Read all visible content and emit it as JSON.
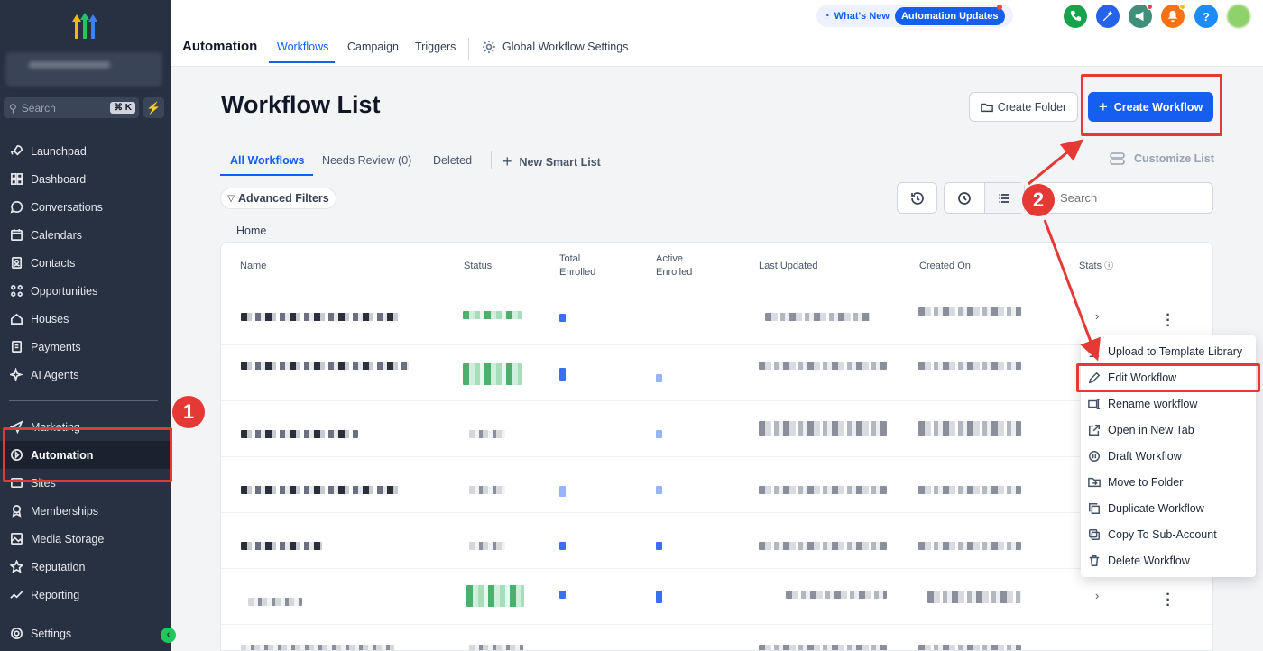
{
  "colors": {
    "sidebar_bg": "#273142",
    "brand": "#155eef",
    "annotation": "#e53935"
  },
  "sidebar": {
    "search_placeholder": "Search",
    "search_shortcut": "⌘ K",
    "items": [
      {
        "label": "Launchpad",
        "icon": "rocket-icon"
      },
      {
        "label": "Dashboard",
        "icon": "grid-icon"
      },
      {
        "label": "Conversations",
        "icon": "chat-icon"
      },
      {
        "label": "Calendars",
        "icon": "calendar-icon"
      },
      {
        "label": "Contacts",
        "icon": "contacts-icon"
      },
      {
        "label": "Opportunities",
        "icon": "opportunities-icon"
      },
      {
        "label": "Houses",
        "icon": "house-icon"
      },
      {
        "label": "Payments",
        "icon": "payments-icon"
      },
      {
        "label": "AI Agents",
        "icon": "sparkle-icon"
      }
    ],
    "items2": [
      {
        "label": "Marketing",
        "icon": "send-icon"
      },
      {
        "label": "Automation",
        "icon": "automation-icon",
        "active": true
      },
      {
        "label": "Sites",
        "icon": "sites-icon"
      },
      {
        "label": "Memberships",
        "icon": "badge-icon"
      },
      {
        "label": "Media Storage",
        "icon": "image-icon"
      },
      {
        "label": "Reputation",
        "icon": "star-icon"
      },
      {
        "label": "Reporting",
        "icon": "chart-icon"
      }
    ],
    "settings": "Settings"
  },
  "topbar": {
    "section": "Automation",
    "tabs": [
      "Workflows",
      "Campaign",
      "Triggers"
    ],
    "global_settings": "Global Workflow Settings",
    "whats_new": "What's New",
    "updates_pill": "Automation Updates",
    "help": "?"
  },
  "main": {
    "title": "Workflow List",
    "create_folder": "Create Folder",
    "create_workflow": "Create Workflow",
    "subtabs": [
      "All Workflows",
      "Needs Review (0)",
      "Deleted"
    ],
    "new_smart_list": "New Smart List",
    "customize_list": "Customize List",
    "advanced_filters": "Advanced Filters",
    "search_placeholder": "Search",
    "breadcrumb": "Home"
  },
  "table": {
    "headers": {
      "name": "Name",
      "status": "Status",
      "total_1": "Total",
      "total_2": "Enrolled",
      "active_1": "Active",
      "active_2": "Enrolled",
      "last_updated": "Last Updated",
      "created_on": "Created On",
      "stats": "Stats"
    }
  },
  "menu": {
    "items": [
      "Upload to Template Library",
      "Edit Workflow",
      "Rename workflow",
      "Open in New Tab",
      "Draft Workflow",
      "Move to Folder",
      "Duplicate Workflow",
      "Copy To Sub-Account",
      "Delete Workflow"
    ]
  },
  "annotations": {
    "step1": "1",
    "step2": "2"
  }
}
